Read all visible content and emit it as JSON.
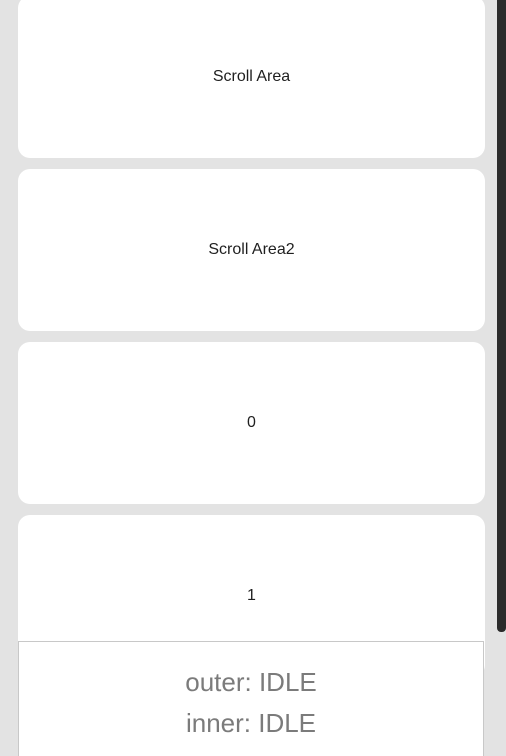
{
  "list": {
    "items": [
      {
        "label": "Scroll Area"
      },
      {
        "label": "Scroll Area2"
      },
      {
        "label": "0"
      },
      {
        "label": "1"
      }
    ]
  },
  "status": {
    "outer": "outer: IDLE",
    "inner": "inner: IDLE"
  },
  "colors": {
    "background": "#e3e3e3",
    "card": "#ffffff",
    "scrollbar": "#2b2b2b",
    "status_text": "#7b7b7b"
  }
}
